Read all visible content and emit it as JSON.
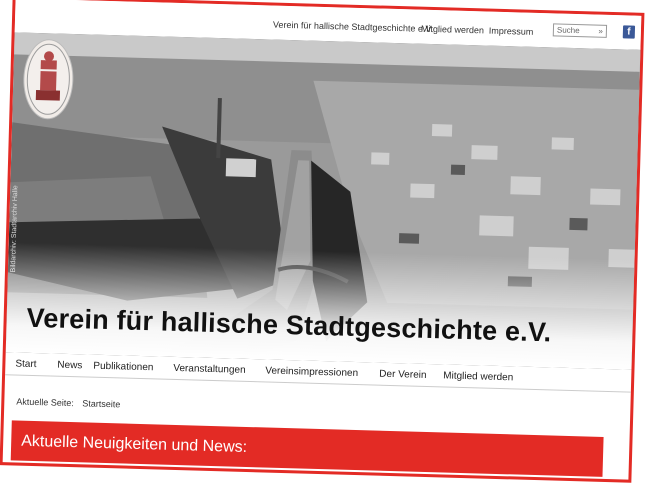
{
  "topbar": {
    "links": [
      "Verein für hallische Stadtgeschichte e.V.",
      "Mitglied werden",
      "Impressum"
    ],
    "search_placeholder": "Suche",
    "search_go": "»",
    "social_icon": "facebook-icon"
  },
  "hero": {
    "title": "Verein für hallische Stadtgeschichte e.V.",
    "credit": "Bildarchiv: Stadtarchiv Halle",
    "logo_icon": "coat-of-arms-icon"
  },
  "nav": {
    "items": [
      "Start",
      "News",
      "Publikationen",
      "Veranstaltungen",
      "Vereinsimpressionen",
      "Der Verein",
      "Mitglied werden"
    ]
  },
  "breadcrumb": {
    "label": "Aktuelle Seite:",
    "current": "Startseite"
  },
  "news": {
    "title": "Aktuelle Neuigkeiten und News:"
  },
  "colors": {
    "accent": "#e32b25",
    "facebook": "#3b5998"
  }
}
